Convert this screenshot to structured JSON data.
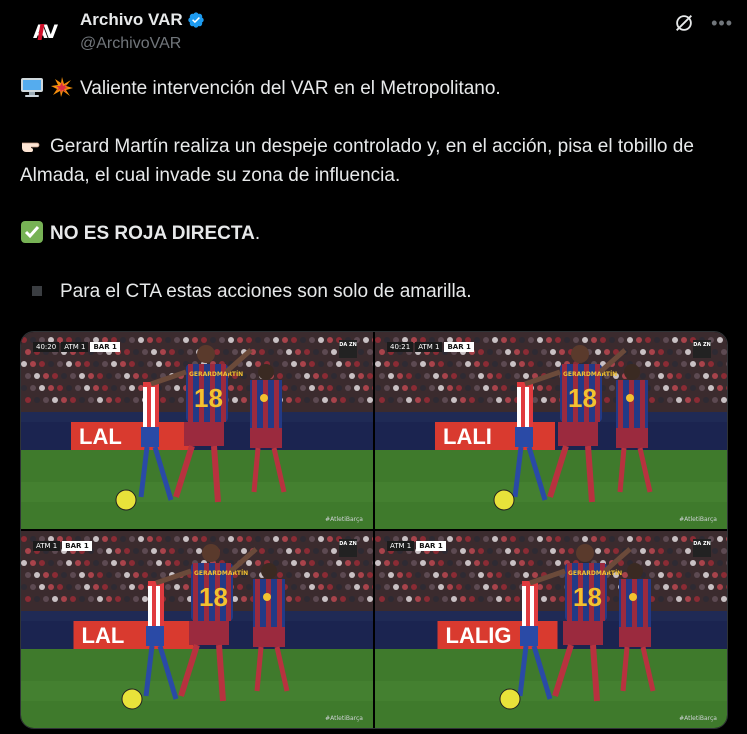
{
  "post": {
    "author": {
      "display_name": "Archivo VAR",
      "handle": "@ArchivoVAR",
      "verified": true
    },
    "icons": {
      "grok": "grok-icon",
      "more": "more-icon",
      "verified": "verified-badge-icon"
    },
    "text": {
      "line1": "Valiente intervención del VAR en el Metropolitano.",
      "line2": "Gerard Martín realiza un despeje controlado y, en el acción, pisa el tobillo de Almada, el cual invade su zona de influencia.",
      "line3_bold": "NO ES ROJA DIRECTA",
      "line3_tail": ".",
      "line4": "Para el CTA estas acciones son solo de amarilla."
    },
    "emojis": {
      "line1": [
        "desktop-computer-emoji",
        "collision-emoji"
      ],
      "line2": "backhand-index-pointing-right-emoji",
      "line3": "check-mark-button-emoji",
      "line4": "small-black-square-emoji"
    }
  },
  "media": {
    "frames": [
      {
        "clock": "40:20",
        "home": "ATM",
        "away": "BAR",
        "score_home": "1",
        "score_away": "1",
        "broadcaster": "DA ZN",
        "watermark": "#AtletiBarça",
        "number": "18",
        "shirt_name": "GERARDMARTÍN",
        "board_text": "LAL"
      },
      {
        "clock": "40:21",
        "home": "ATM",
        "away": "BAR",
        "score_home": "1",
        "score_away": "1",
        "broadcaster": "DA ZN",
        "watermark": "#AtletiBarça",
        "number": "18",
        "shirt_name": "GERARDMARTÍN",
        "board_text": "LALI"
      },
      {
        "clock": "",
        "home": "ATM",
        "away": "BAR",
        "score_home": "1",
        "score_away": "1",
        "broadcaster": "DA ZN",
        "watermark": "#AtletiBarça",
        "number": "18",
        "shirt_name": "GERARDMARTÍN",
        "board_text": "LAL"
      },
      {
        "clock": "",
        "home": "ATM",
        "away": "BAR",
        "score_home": "1",
        "score_away": "1",
        "broadcaster": "DA ZN",
        "watermark": "#AtletiBarça",
        "number": "18",
        "shirt_name": "GERARDMARTÍN",
        "board_text": "LALIG"
      }
    ]
  },
  "colors": {
    "background": "#000000",
    "text": "#e7e9ea",
    "muted": "#71767b",
    "verified": "#1d9bf0",
    "pitch": "#3f7a2c",
    "barca_blue": "#233a86",
    "barca_red": "#9b2a3e"
  }
}
